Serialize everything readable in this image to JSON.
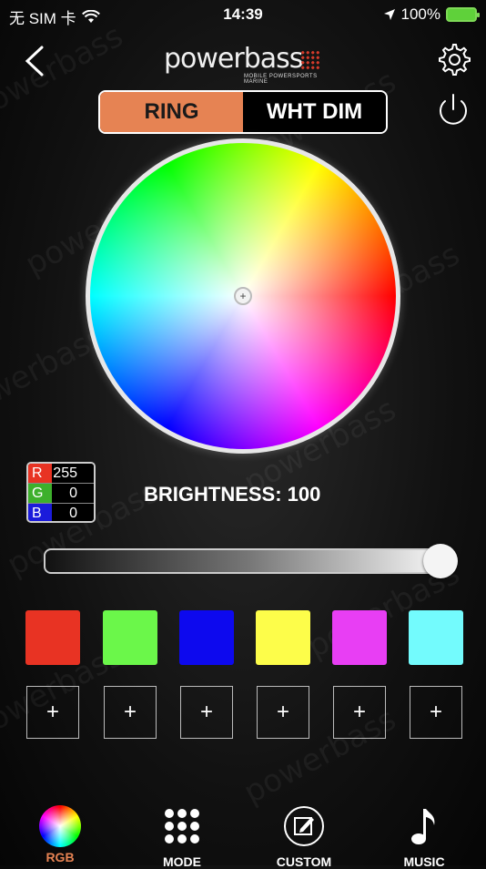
{
  "status": {
    "carrier": "无 SIM 卡",
    "time": "14:39",
    "battery": "100%"
  },
  "header": {
    "logo_text": "powerbass",
    "logo_tagline": "MOBILE POWERSPORTS MARINE"
  },
  "mode_toggle": {
    "ring_label": "RING",
    "white_dim_label": "WHT DIM",
    "selected": "RING"
  },
  "rgb": {
    "r_label": "R",
    "r_value": "255",
    "g_label": "G",
    "g_value": "0",
    "b_label": "B",
    "b_value": "0"
  },
  "brightness": {
    "label": "BRIGHTNESS: 100",
    "value": 100
  },
  "presets": {
    "colors": [
      "#e83323",
      "#6bf74a",
      "#0d09ee",
      "#fdfd4a",
      "#e83ef4",
      "#73fbfd"
    ],
    "add_label": "+"
  },
  "tabs": [
    {
      "label": "RGB",
      "icon": "color-wheel-icon",
      "active": true
    },
    {
      "label": "MODE",
      "icon": "grid-dots-icon",
      "active": false
    },
    {
      "label": "CUSTOM",
      "icon": "edit-icon",
      "active": false
    },
    {
      "label": "MUSIC",
      "icon": "music-note-icon",
      "active": false
    }
  ]
}
